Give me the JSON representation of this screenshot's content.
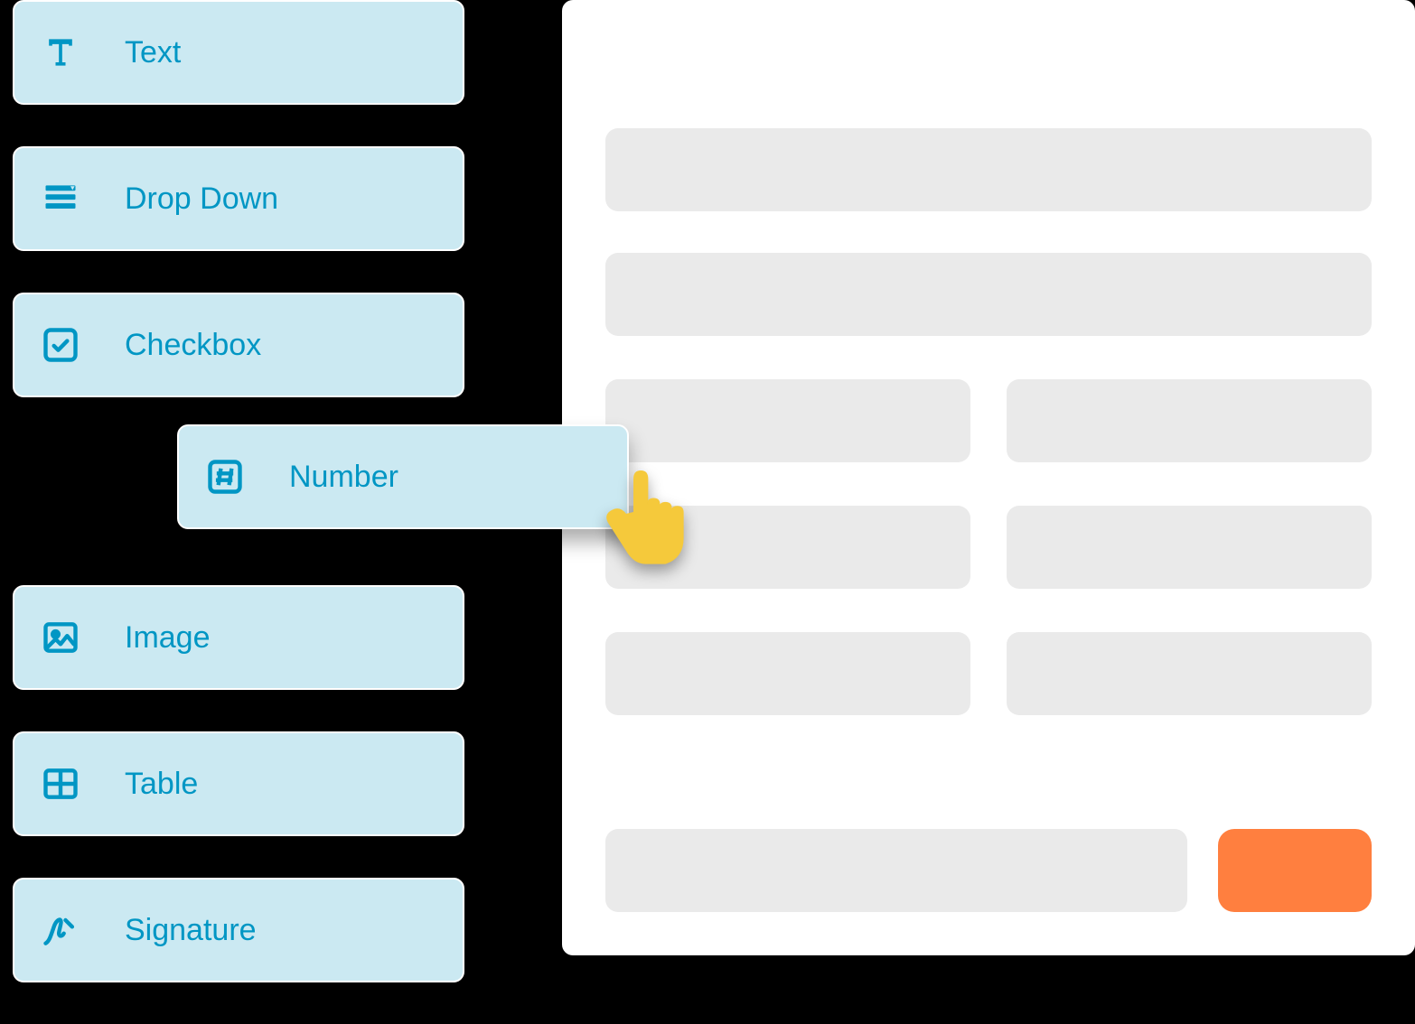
{
  "sidebar": {
    "items": [
      {
        "label": "Text",
        "icon": "text-icon"
      },
      {
        "label": "Drop Down",
        "icon": "dropdown-icon"
      },
      {
        "label": "Checkbox",
        "icon": "checkbox-icon"
      },
      {
        "label": "Number",
        "icon": "number-icon",
        "dragging": true
      },
      {
        "label": "Image",
        "icon": "image-icon"
      },
      {
        "label": "Table",
        "icon": "table-icon"
      },
      {
        "label": "Signature",
        "icon": "signature-icon"
      }
    ]
  },
  "colors": {
    "accent": "#0096c4",
    "tile_bg": "#cbe9f2",
    "placeholder": "#eaeaea",
    "submit": "#ff7f3f"
  }
}
